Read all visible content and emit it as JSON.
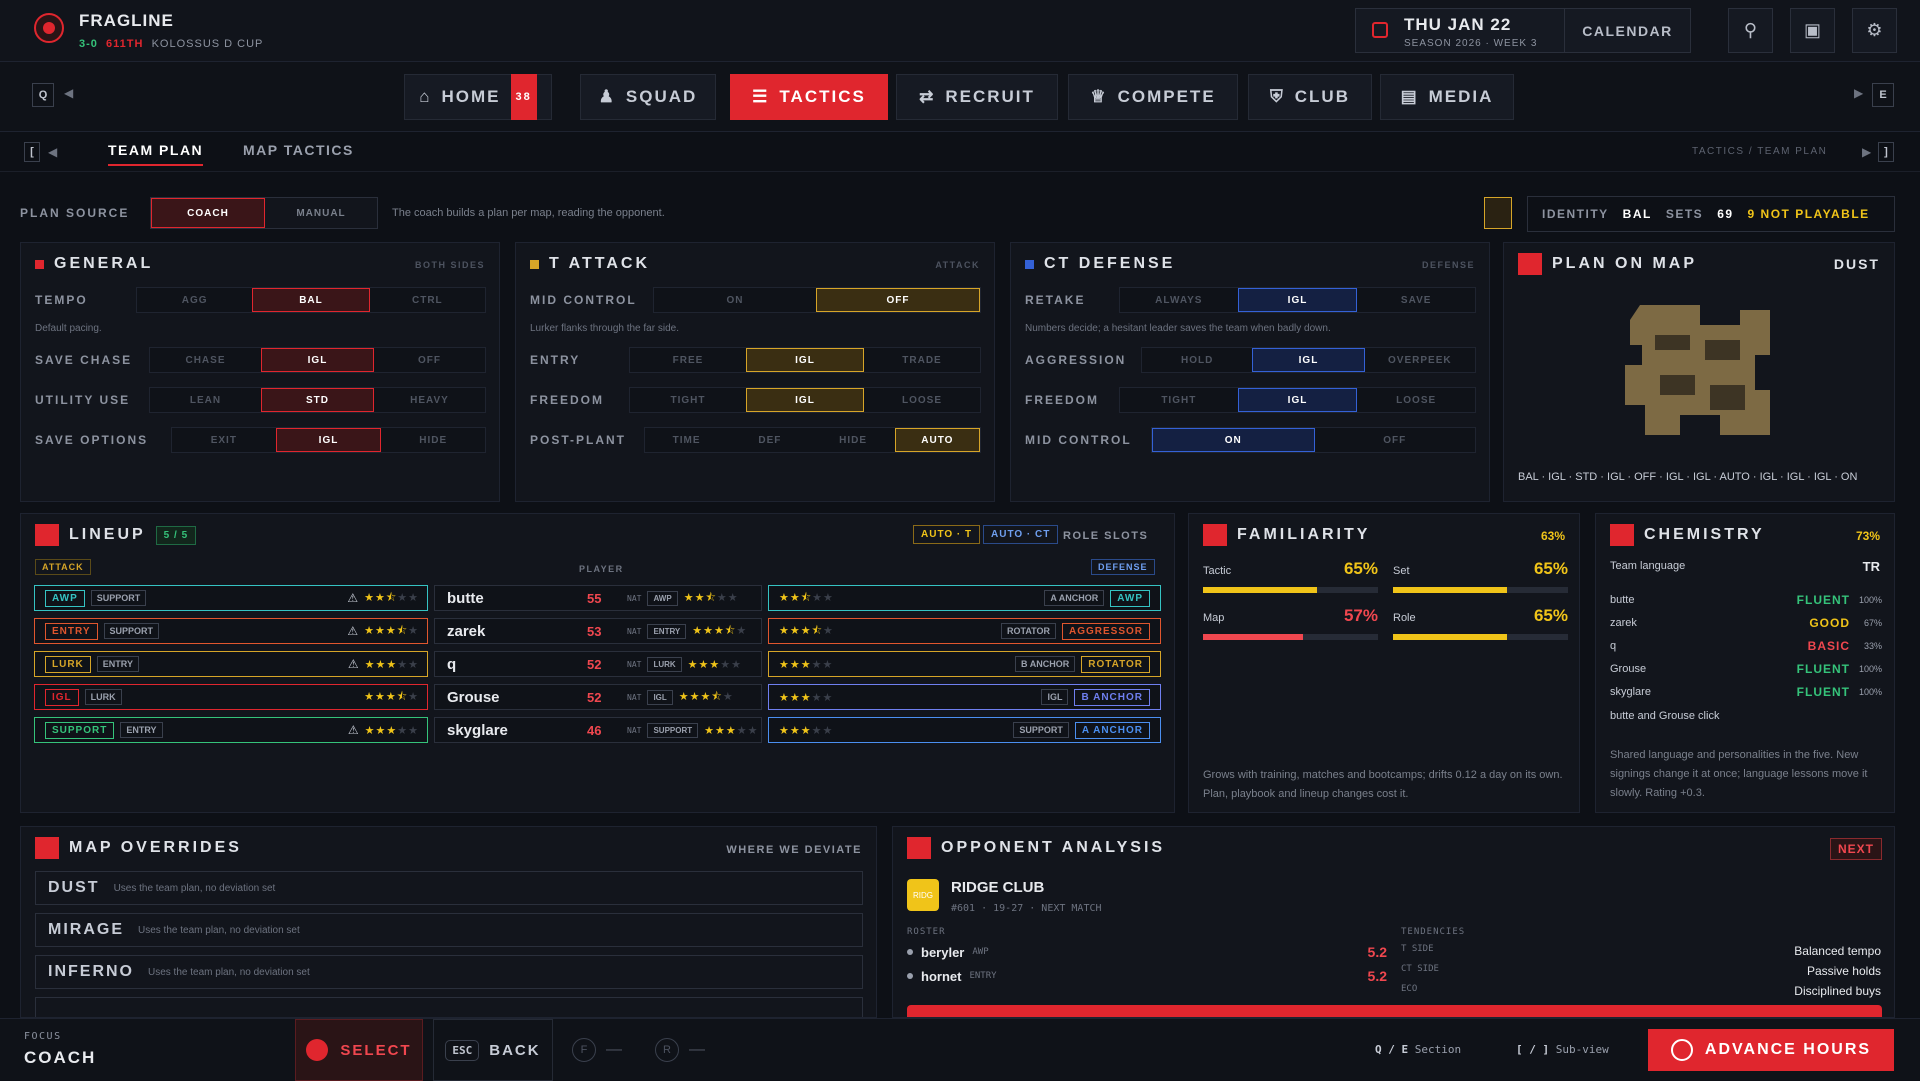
{
  "club": {
    "name": "FRAGLINE",
    "record": "3-0",
    "rank": "611TH",
    "league": "KOLOSSUS D CUP"
  },
  "date": {
    "day": "THU JAN 22",
    "season": "SEASON 2026 · WEEK 3",
    "calendar_label": "CALENDAR"
  },
  "nav": {
    "left_key": "Q",
    "right_key": "E",
    "tabs": [
      {
        "label": "HOME",
        "badge": "38"
      },
      {
        "label": "SQUAD"
      },
      {
        "label": "TACTICS",
        "active": true
      },
      {
        "label": "RECRUIT"
      },
      {
        "label": "COMPETE"
      },
      {
        "label": "CLUB"
      },
      {
        "label": "MEDIA"
      }
    ]
  },
  "subnav": {
    "left_key": "[",
    "right_key": "]",
    "tabs": [
      "TEAM PLAN",
      "MAP TACTICS"
    ],
    "breadcrumb": "TACTICS / TEAM PLAN"
  },
  "plan_source": {
    "label": "PLAN SOURCE",
    "options": [
      "COACH",
      "MANUAL"
    ],
    "selected": "COACH",
    "note": "The coach builds a plan per map, reading the opponent."
  },
  "identity": {
    "identity_label": "IDENTITY",
    "identity_value": "BAL",
    "sets_label": "SETS",
    "sets_value": "69",
    "warning": "9 NOT PLAYABLE"
  },
  "general": {
    "title": "GENERAL",
    "tag": "BOTH SIDES",
    "rows": [
      {
        "label": "TEMPO",
        "options": [
          "AGG",
          "BAL",
          "CTRL"
        ],
        "sel": 1,
        "hint": "Default pacing."
      },
      {
        "label": "SAVE CHASE",
        "options": [
          "CHASE",
          "IGL",
          "OFF"
        ],
        "sel": 1
      },
      {
        "label": "UTILITY USE",
        "options": [
          "LEAN",
          "STD",
          "HEAVY"
        ],
        "sel": 1
      },
      {
        "label": "SAVE OPTIONS",
        "options": [
          "EXIT",
          "IGL",
          "HIDE"
        ],
        "sel": 1
      }
    ]
  },
  "t_attack": {
    "title": "T ATTACK",
    "tag": "ATTACK",
    "rows": [
      {
        "label": "MID CONTROL",
        "options": [
          "ON",
          "OFF"
        ],
        "sel": 1,
        "hint": "Lurker flanks through the far side."
      },
      {
        "label": "ENTRY",
        "options": [
          "FREE",
          "IGL",
          "TRADE"
        ],
        "sel": 1
      },
      {
        "label": "FREEDOM",
        "options": [
          "TIGHT",
          "IGL",
          "LOOSE"
        ],
        "sel": 1
      },
      {
        "label": "POST-PLANT",
        "options": [
          "TIME",
          "DEF",
          "HIDE",
          "AUTO"
        ],
        "sel": 3
      }
    ]
  },
  "ct_defense": {
    "title": "CT DEFENSE",
    "tag": "DEFENSE",
    "rows": [
      {
        "label": "RETAKE",
        "options": [
          "ALWAYS",
          "IGL",
          "SAVE"
        ],
        "sel": 1,
        "hint": "Numbers decide; a hesitant leader saves the team when badly down."
      },
      {
        "label": "AGGRESSION",
        "options": [
          "HOLD",
          "IGL",
          "OVERPEEK"
        ],
        "sel": 1
      },
      {
        "label": "FREEDOM",
        "options": [
          "TIGHT",
          "IGL",
          "LOOSE"
        ],
        "sel": 1
      },
      {
        "label": "MID CONTROL",
        "options": [
          "ON",
          "OFF"
        ],
        "sel": 0
      }
    ]
  },
  "plan_map": {
    "title": "PLAN ON MAP",
    "map": "DUST",
    "summary": "BAL · IGL · STD · IGL · OFF · IGL · IGL · AUTO · IGL · IGL · IGL · ON"
  },
  "lineup": {
    "title": "LINEUP",
    "count": "5 / 5",
    "auto_t": "AUTO · T",
    "auto_ct": "AUTO · CT",
    "role_slots": "ROLE SLOTS",
    "attack_label": "ATTACK",
    "player_label": "PLAYER",
    "defense_label": "DEFENSE",
    "nat_label": "NAT",
    "rows": [
      {
        "t_role": "AWP",
        "t_color": "#35c3c3",
        "t_sec": "SUPPORT",
        "t_stars": 2.5,
        "warn": true,
        "name": "butte",
        "ovr": "55",
        "nat": "AWP",
        "nat_stars": 2.5,
        "ct_stars": 2.5,
        "ct_sec": "A ANCHOR",
        "ct_role": "AWP",
        "ct_color": "#35c3c3"
      },
      {
        "t_role": "ENTRY",
        "t_color": "#e0562e",
        "t_sec": "SUPPORT",
        "t_stars": 3.5,
        "warn": true,
        "name": "zarek",
        "ovr": "53",
        "nat": "ENTRY",
        "nat_stars": 3.5,
        "ct_stars": 3.5,
        "ct_sec": "ROTATOR",
        "ct_role": "AGGRESSOR",
        "ct_color": "#e0562e"
      },
      {
        "t_role": "LURK",
        "t_color": "#d6a528",
        "t_sec": "ENTRY",
        "t_stars": 3,
        "warn": true,
        "name": "q",
        "ovr": "52",
        "nat": "LURK",
        "nat_stars": 3,
        "ct_stars": 3,
        "ct_sec": "B ANCHOR",
        "ct_role": "ROTATOR",
        "ct_color": "#d6a528"
      },
      {
        "t_role": "IGL",
        "t_color": "#e0262e",
        "t_sec": "LURK",
        "t_stars": 3.5,
        "warn": false,
        "name": "Grouse",
        "ovr": "52",
        "nat": "IGL",
        "nat_stars": 3.5,
        "ct_stars": 3,
        "ct_sec": "IGL",
        "ct_role": "B ANCHOR",
        "ct_color": "#6f7ff0"
      },
      {
        "t_role": "SUPPORT",
        "t_color": "#35c37a",
        "t_sec": "ENTRY",
        "t_stars": 3,
        "warn": true,
        "name": "skyglare",
        "ovr": "46",
        "nat": "SUPPORT",
        "nat_stars": 3,
        "ct_stars": 3,
        "ct_sec": "SUPPORT",
        "ct_role": "A ANCHOR",
        "ct_color": "#4b8ff0"
      }
    ]
  },
  "familiarity": {
    "title": "FAMILIARITY",
    "value": "63%",
    "items": [
      {
        "label": "Tactic",
        "value": "65%",
        "pct": 0.65,
        "color": "#f0c419"
      },
      {
        "label": "Set",
        "value": "65%",
        "pct": 0.65,
        "color": "#f0c419"
      },
      {
        "label": "Map",
        "value": "57%",
        "pct": 0.57,
        "color": "#f0474f"
      },
      {
        "label": "Role",
        "value": "65%",
        "pct": 0.65,
        "color": "#f0c419"
      }
    ],
    "note": "Grows with training, matches and bootcamps; drifts 0.12 a day on its own. Plan, playbook and lineup changes cost it."
  },
  "chemistry": {
    "title": "CHEMISTRY",
    "value": "73%",
    "lang_label": "Team language",
    "lang_value": "TR",
    "players": [
      {
        "name": "butte",
        "level": "FLUENT",
        "pct": "100%",
        "color": "#35c37a"
      },
      {
        "name": "zarek",
        "level": "GOOD",
        "pct": "67%",
        "color": "#f0c419"
      },
      {
        "name": "q",
        "level": "BASIC",
        "pct": "33%",
        "color": "#f0474f"
      },
      {
        "name": "Grouse",
        "level": "FLUENT",
        "pct": "100%",
        "color": "#35c37a"
      },
      {
        "name": "skyglare",
        "level": "FLUENT",
        "pct": "100%",
        "color": "#35c37a"
      }
    ],
    "click": "butte and Grouse click",
    "note": "Shared language and personalities in the five. New signings change it at once; language lessons move it slowly. Rating +0.3."
  },
  "map_overrides": {
    "title": "MAP OVERRIDES",
    "tag": "WHERE WE DEVIATE",
    "maps": [
      {
        "name": "DUST",
        "note": "Uses the team plan, no deviation set"
      },
      {
        "name": "MIRAGE",
        "note": "Uses the team plan, no deviation set"
      },
      {
        "name": "INFERNO",
        "note": "Uses the team plan, no deviation set"
      }
    ]
  },
  "opponent": {
    "title": "OPPONENT ANALYSIS",
    "next": "NEXT",
    "logo_text": "RIDG",
    "name": "RIDGE CLUB",
    "meta": "#601 · 19-27 · NEXT MATCH",
    "roster_label": "ROSTER",
    "tendencies_label": "TENDENCIES",
    "roster": [
      {
        "name": "beryler",
        "role": "AWP",
        "rating": "5.2"
      },
      {
        "name": "hornet",
        "role": "ENTRY",
        "rating": "5.2"
      }
    ],
    "tendencies": [
      {
        "k": "T SIDE",
        "v": "Balanced tempo"
      },
      {
        "k": "CT SIDE",
        "v": "Passive holds"
      },
      {
        "k": "ECO",
        "v": "Disciplined buys"
      }
    ]
  },
  "footer": {
    "focus_label": "FOCUS",
    "focus_value": "COACH",
    "select": "SELECT",
    "back": "BACK",
    "esc": "ESC",
    "f_key": "F",
    "r_key": "R",
    "dash": "—",
    "hint1_keys": "Q / E",
    "hint1": "Section",
    "hint2_keys": "[ / ]",
    "hint2": "Sub-view",
    "advance": "ADVANCE HOURS"
  },
  "colors": {
    "accent": "#e0262e",
    "gold": "#d6a528",
    "blue": "#3461d6",
    "green": "#35c37a"
  }
}
